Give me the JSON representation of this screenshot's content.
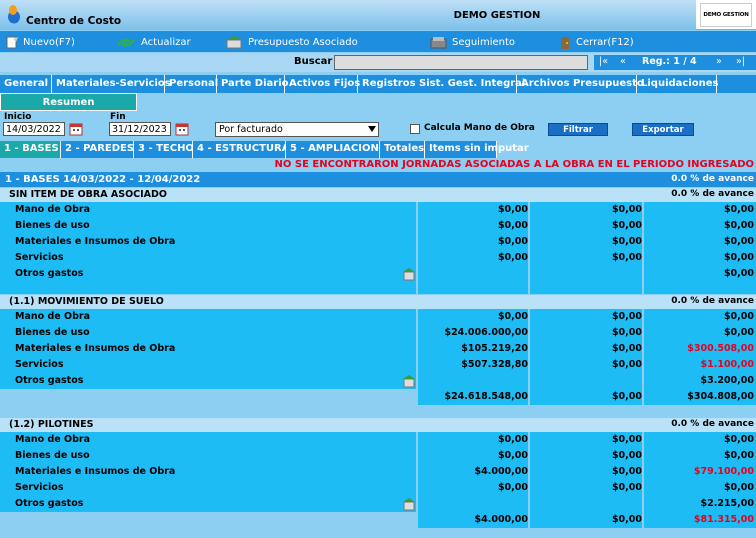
{
  "window": {
    "title": "Centro de Costo",
    "company": "DEMO GESTION",
    "brand": "DEMO GESTION"
  },
  "toolbar": {
    "nuevo": "Nuevo(F7)",
    "actualizar": "Actualizar",
    "presupuesto": "Presupuesto Asociado",
    "seguimiento": "Seguimiento",
    "cerrar": "Cerrar(F12)"
  },
  "search": {
    "label": "Buscar",
    "value": "",
    "pager_first": "|«",
    "pager_prev": "«",
    "reg": "Reg.: 1 / 4",
    "pager_next": "»",
    "pager_last": "»|"
  },
  "tabs": [
    "General",
    "Materiales-Servicios",
    "Personal",
    "Parte Diario",
    "Activos Fijos",
    "Registros Sist. Gest. Integral",
    "Archivos Presupuesto",
    "Liquidaciones"
  ],
  "active_tab": "Resumen",
  "filters": {
    "inicio_label": "Inicio",
    "inicio_value": "14/03/2022",
    "fin_label": "Fin",
    "fin_value": "31/12/2023",
    "select_value": "Por facturado",
    "check_label": "Calcula Mano de Obra",
    "filtrar": "Filtrar",
    "exportar": "Exportar"
  },
  "subtabs": [
    "1 - BASES",
    "2 - PAREDES",
    "3 - TECHO",
    "4 - ESTRUCTURA",
    "5 - AMPLIACION",
    "Totales",
    "Items sin imputar"
  ],
  "alert": "NO SE ENCONTRARON JORNADAS ASOCIADAS A LA OBRA EN EL PERIODO INGRESADO",
  "group": {
    "title": "1 - BASES 14/03/2022 - 12/04/2022",
    "pct": "0.0 % de avance"
  },
  "sections": [
    {
      "title": "SIN ITEM DE OBRA ASOCIADO",
      "pct": "0.0 % de avance",
      "rows": [
        {
          "label": "Mano de Obra",
          "c1": "$0,00",
          "c2": "$0,00",
          "c3": "$0,00",
          "red": false
        },
        {
          "label": "Bienes de uso",
          "c1": "$0,00",
          "c2": "$0,00",
          "c3": "$0,00",
          "red": false
        },
        {
          "label": "Materiales e Insumos de Obra",
          "c1": "$0,00",
          "c2": "$0,00",
          "c3": "$0,00",
          "red": false
        },
        {
          "label": "Servicios",
          "c1": "$0,00",
          "c2": "$0,00",
          "c3": "$0,00",
          "red": false
        },
        {
          "label": "Otros gastos",
          "c1": "",
          "c2": "",
          "c3": "$0,00",
          "red": false,
          "icon": true
        }
      ]
    },
    {
      "title": "(1.1) MOVIMIENTO DE SUELO",
      "pct": "0.0 % de avance",
      "rows": [
        {
          "label": "Mano de Obra",
          "c1": "$0,00",
          "c2": "$0,00",
          "c3": "$0,00",
          "red": false
        },
        {
          "label": "Bienes de uso",
          "c1": "$24.006.000,00",
          "c2": "$0,00",
          "c3": "$0,00",
          "red": false
        },
        {
          "label": "Materiales e Insumos de Obra",
          "c1": "$105.219,20",
          "c2": "$0,00",
          "c3": "$300.508,00",
          "red": true
        },
        {
          "label": "Servicios",
          "c1": "$507.328,80",
          "c2": "$0,00",
          "c3": "$1.100,00",
          "red": true
        },
        {
          "label": "Otros gastos",
          "c1": "",
          "c2": "",
          "c3": "$3.200,00",
          "red": false,
          "icon": true
        }
      ],
      "total": {
        "c1": "$24.618.548,00",
        "c2": "$0,00",
        "c3": "$304.808,00",
        "red": false
      }
    },
    {
      "title": "(1.2) PILOTINES",
      "pct": "0.0 % de avance",
      "rows": [
        {
          "label": "Mano de Obra",
          "c1": "$0,00",
          "c2": "$0,00",
          "c3": "$0,00",
          "red": false
        },
        {
          "label": "Bienes de uso",
          "c1": "$0,00",
          "c2": "$0,00",
          "c3": "$0,00",
          "red": false
        },
        {
          "label": "Materiales e Insumos de Obra",
          "c1": "$4.000,00",
          "c2": "$0,00",
          "c3": "$79.100,00",
          "red": true
        },
        {
          "label": "Servicios",
          "c1": "$0,00",
          "c2": "$0,00",
          "c3": "$0,00",
          "red": false
        },
        {
          "label": "Otros gastos",
          "c1": "",
          "c2": "",
          "c3": "$2.215,00",
          "red": false,
          "icon": true
        }
      ],
      "total": {
        "c1": "$4.000,00",
        "c2": "$0,00",
        "c3": "$81.315,00",
        "red": true
      }
    }
  ],
  "colors": {
    "toolbar": "#1e8ede",
    "row": "#1ebcf5",
    "bg": "#8ccff2",
    "alert": "#e8001c",
    "active_tab": "#1aa8a8"
  }
}
